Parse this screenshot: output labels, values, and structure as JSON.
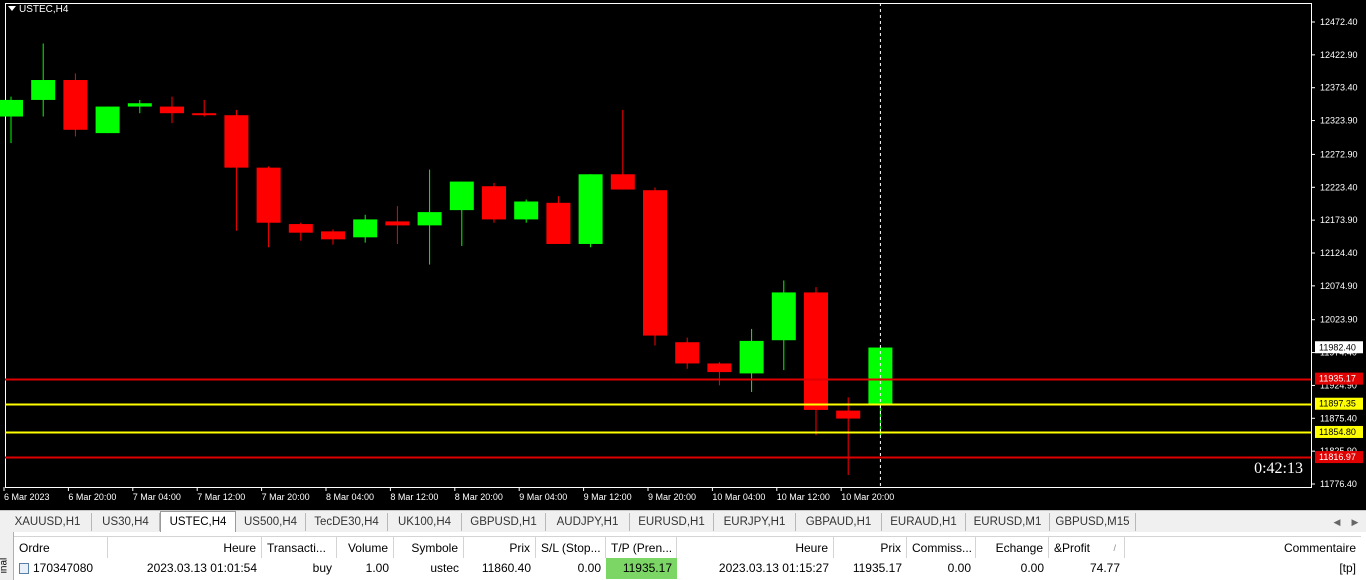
{
  "chart": {
    "symbol_label": "USTEC,H4",
    "countdown": "0:42:13",
    "current_price_label": "11982.40",
    "price_ticks": [
      "12472.40",
      "12422.90",
      "12373.40",
      "12323.90",
      "12272.90",
      "12223.40",
      "12173.90",
      "12124.40",
      "12074.90",
      "12023.90",
      "11974.40",
      "11924.90",
      "11875.40",
      "11825.90",
      "11776.40"
    ],
    "time_ticks": [
      "6 Mar 2023",
      "6 Mar 20:00",
      "7 Mar 04:00",
      "7 Mar 12:00",
      "7 Mar 20:00",
      "8 Mar 04:00",
      "8 Mar 12:00",
      "8 Mar 20:00",
      "9 Mar 04:00",
      "9 Mar 12:00",
      "9 Mar 20:00",
      "10 Mar 04:00",
      "10 Mar 12:00",
      "10 Mar 20:00"
    ],
    "levels": [
      {
        "price": 11935.17,
        "color": "#e00000",
        "label": "11935.17"
      },
      {
        "price": 11897.35,
        "color": "#ffff00",
        "label": "11897.35"
      },
      {
        "price": 11854.8,
        "color": "#ffff00",
        "label": "11854.80"
      },
      {
        "price": 11816.97,
        "color": "#e00000",
        "label": "11816.97"
      }
    ],
    "colors": {
      "bull": "#00ff00",
      "bear": "#ff0000",
      "background": "#000000",
      "axis": "#ffffff"
    },
    "candles": [
      {
        "o": 12330,
        "h": 12360,
        "l": 12290,
        "c": 12355
      },
      {
        "o": 12355,
        "h": 12440,
        "l": 12330,
        "c": 12385
      },
      {
        "o": 12385,
        "h": 12395,
        "l": 12300,
        "c": 12310
      },
      {
        "o": 12305,
        "h": 12345,
        "l": 12305,
        "c": 12345
      },
      {
        "o": 12345,
        "h": 12355,
        "l": 12335,
        "c": 12350
      },
      {
        "o": 12345,
        "h": 12360,
        "l": 12320,
        "c": 12335
      },
      {
        "o": 12335,
        "h": 12355,
        "l": 12330,
        "c": 12332
      },
      {
        "o": 12332,
        "h": 12340,
        "l": 12158,
        "c": 12253
      },
      {
        "o": 12253,
        "h": 12255,
        "l": 12133,
        "c": 12170
      },
      {
        "o": 12168,
        "h": 12170,
        "l": 12143,
        "c": 12155
      },
      {
        "o": 12157,
        "h": 12160,
        "l": 12137,
        "c": 12145
      },
      {
        "o": 12148,
        "h": 12182,
        "l": 12140,
        "c": 12175
      },
      {
        "o": 12172,
        "h": 12195,
        "l": 12138,
        "c": 12166
      },
      {
        "o": 12166,
        "h": 12250,
        "l": 12107,
        "c": 12186
      },
      {
        "o": 12189,
        "h": 12232,
        "l": 12135,
        "c": 12232
      },
      {
        "o": 12225,
        "h": 12230,
        "l": 12170,
        "c": 12175
      },
      {
        "o": 12175,
        "h": 12205,
        "l": 12170,
        "c": 12202
      },
      {
        "o": 12200,
        "h": 12210,
        "l": 12140,
        "c": 12138
      },
      {
        "o": 12138,
        "h": 12243,
        "l": 12133,
        "c": 12243
      },
      {
        "o": 12243,
        "h": 12340,
        "l": 12220,
        "c": 12220
      },
      {
        "o": 12219,
        "h": 12223,
        "l": 11985,
        "c": 12000
      },
      {
        "o": 11990,
        "h": 11997,
        "l": 11950,
        "c": 11958
      },
      {
        "o": 11958,
        "h": 11960,
        "l": 11925,
        "c": 11945
      },
      {
        "o": 11943,
        "h": 12010,
        "l": 11915,
        "c": 11992
      },
      {
        "o": 11993,
        "h": 12083,
        "l": 11948,
        "c": 12065
      },
      {
        "o": 12065,
        "h": 12073,
        "l": 11850,
        "c": 11888
      },
      {
        "o": 11887,
        "h": 11907,
        "l": 11790,
        "c": 11875
      },
      {
        "o": 11897,
        "h": 11982,
        "l": 11850,
        "c": 11982
      }
    ]
  },
  "tabs": [
    {
      "label": "XAUUSD,H1",
      "active": false
    },
    {
      "label": "US30,H4",
      "active": false
    },
    {
      "label": "USTEC,H4",
      "active": true
    },
    {
      "label": "US500,H4",
      "active": false
    },
    {
      "label": "TecDE30,H4",
      "active": false
    },
    {
      "label": "UK100,H4",
      "active": false
    },
    {
      "label": "GBPUSD,H1",
      "active": false
    },
    {
      "label": "AUDJPY,H1",
      "active": false
    },
    {
      "label": "EURUSD,H1",
      "active": false
    },
    {
      "label": "EURJPY,H1",
      "active": false
    },
    {
      "label": "GBPAUD,H1",
      "active": false
    },
    {
      "label": "EURAUD,H1",
      "active": false
    },
    {
      "label": "EURUSD,M1",
      "active": false
    },
    {
      "label": "GBPUSD,M15",
      "active": false
    }
  ],
  "terminal": {
    "side_label": "inal",
    "columns": [
      "Ordre",
      "Heure",
      "Transacti...",
      "Volume",
      "Symbole",
      "Prix",
      "S/L (Stop...",
      "T/P (Pren...",
      "Heure",
      "Prix",
      "Commiss...",
      "Echange",
      "&Profit",
      "/",
      "Commentaire"
    ],
    "row": {
      "order": "170347080",
      "open_time": "2023.03.13 01:01:54",
      "type": "buy",
      "volume": "1.00",
      "symbol": "ustec",
      "price": "11860.40",
      "sl": "0.00",
      "tp": "11935.17",
      "close_time": "2023.03.13 01:15:27",
      "close_price": "11935.17",
      "commission": "0.00",
      "swap": "0.00",
      "profit": "74.77",
      "comment": "[tp]"
    }
  }
}
